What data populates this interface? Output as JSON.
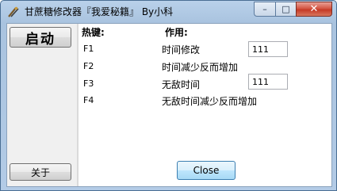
{
  "window": {
    "title": "甘蔗糖修改器『我爱秘籍』 By小科",
    "buttons": {
      "minimize": "–",
      "maximize": "□",
      "close": "✕"
    }
  },
  "left_panel": {
    "start_label": "启动",
    "about_label": "关于"
  },
  "headers": {
    "hotkey": "热键:",
    "function": "作用:"
  },
  "rows": [
    {
      "key": "F1",
      "desc": "时间修改",
      "value": "111"
    },
    {
      "key": "F2",
      "desc": "时间减少反而增加"
    },
    {
      "key": "F3",
      "desc": "无敌时间",
      "value": "111"
    },
    {
      "key": "F4",
      "desc": "无敌时间减少反而增加"
    }
  ],
  "footer": {
    "close_label": "Close"
  },
  "colors": {
    "frame": "#b9d1ea",
    "close_button": "#c53a26",
    "default_button_border": "#3c7fb1"
  },
  "icons": {
    "app": "app-icon"
  }
}
